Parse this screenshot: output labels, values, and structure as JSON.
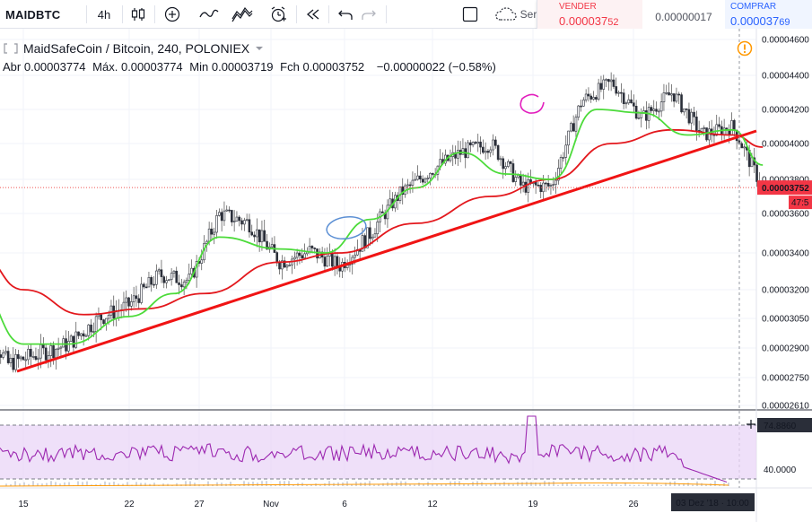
{
  "toolbar": {
    "symbol": "MAIDBTC",
    "interval": "4h",
    "server_label": "Ser",
    "icons": [
      "candles-icon",
      "add-indicator-icon",
      "line-style-icon",
      "indicators-icon",
      "alert-icon",
      "replay-icon",
      "undo-icon",
      "redo-icon",
      "checkbox-icon",
      "cloud-save-icon"
    ]
  },
  "trade": {
    "sell_label": "VENDER",
    "sell_price_main": "0.000037",
    "sell_price_accent": "52",
    "spread": "0.00000017",
    "buy_label": "COMPRAR",
    "buy_price_main": "0.000037",
    "buy_price_accent": "69",
    "sell_color": "#f23645",
    "buy_color": "#2962ff"
  },
  "legend": {
    "title": "MaidSafeCoin / Bitcoin, 240, POLONIEX",
    "open_label": "Abr",
    "open": "0.00003774",
    "high_label": "Máx.",
    "high": "0.00003774",
    "low_label": "Min",
    "low": "0.00003719",
    "close_label": "Fch",
    "close": "0.00003752",
    "change": "−0.00000022 (−0.58%)",
    "alert_icon": "warning-icon"
  },
  "price_axis": {
    "ticks": [
      "0.00004600",
      "0.00004400",
      "0.00004200",
      "0.00004000",
      "0.00003800",
      "0.00003600",
      "0.00003400",
      "0.00003200",
      "0.00003050",
      "0.00002900",
      "0.00002750",
      "0.00002610"
    ],
    "last_price": "0.00003752",
    "countdown": "47:5",
    "last_price_color": "#f23645"
  },
  "rsi_axis": {
    "upper_value": "74.8860",
    "lower_value": "40.0000"
  },
  "time_axis": {
    "ticks": [
      "15",
      "22",
      "27",
      "Nov",
      "6",
      "12",
      "19",
      "26"
    ],
    "crosshair_label": "03 Dez '18 · 10:00"
  },
  "chart_data": {
    "type": "line",
    "title": "MaidSafeCoin / Bitcoin, 240, POLONIEX",
    "xlabel": "",
    "ylabel": "",
    "ylim": [
      2.61e-05,
      4.6e-05
    ],
    "series": [
      {
        "name": "",
        "color": "#26a69a",
        "x": [
          "2018-10-12",
          "2018-10-14",
          "2018-10-16",
          "2018-10-18",
          "2018-10-20",
          "2018-10-22",
          "2018-10-24",
          "2018-10-26",
          "2018-10-28",
          "2018-10-30",
          "2018-11-01",
          "2018-11-03",
          "2018-11-05",
          "2018-11-07",
          "2018-11-09",
          "2018-11-11",
          "2018-11-13",
          "2018-11-15",
          "2018-11-17",
          "2018-11-19",
          "2018-11-21",
          "2018-11-23",
          "2018-11-25",
          "2018-11-27",
          "2018-11-29",
          "2018-12-01",
          "2018-12-03"
        ],
        "values": [
          3.06e-05,
          2.82e-05,
          2.87e-05,
          2.92e-05,
          3.05e-05,
          3.12e-05,
          3.28e-05,
          3.25e-05,
          3.6e-05,
          3.55e-05,
          3.35e-05,
          3.41e-05,
          3.33e-05,
          3.5e-05,
          3.72e-05,
          3.85e-05,
          3.95e-05,
          4e-05,
          3.76e-05,
          3.76e-05,
          4.25e-05,
          4.36e-05,
          4.15e-05,
          4.3e-05,
          4.05e-05,
          4.1e-05,
          3.75e-05
        ]
      },
      {
        "name": "",
        "color": "#4cdb3a",
        "x": [
          "2018-10-12",
          "2018-10-15",
          "2018-10-18",
          "2018-10-22",
          "2018-10-25",
          "2018-10-28",
          "2018-11-01",
          "2018-11-04",
          "2018-11-07",
          "2018-11-10",
          "2018-11-13",
          "2018-11-16",
          "2018-11-19",
          "2018-11-22",
          "2018-11-25",
          "2018-11-28",
          "2018-12-01",
          "2018-12-03"
        ],
        "values": [
          3.2e-05,
          2.92e-05,
          2.92e-05,
          3.06e-05,
          3.18e-05,
          3.48e-05,
          3.42e-05,
          3.4e-05,
          3.57e-05,
          3.75e-05,
          3.95e-05,
          3.83e-05,
          3.8e-05,
          4.2e-05,
          4.18e-05,
          4.05e-05,
          4.08e-05,
          3.88e-05
        ]
      },
      {
        "name": "",
        "color": "#e3181d",
        "x": [
          "2018-10-12",
          "2018-10-15",
          "2018-10-19",
          "2018-10-23",
          "2018-10-27",
          "2018-11-01",
          "2018-11-05",
          "2018-11-10",
          "2018-11-15",
          "2018-11-19",
          "2018-11-23",
          "2018-11-27",
          "2018-12-01",
          "2018-12-03"
        ],
        "values": [
          3.4e-05,
          3.2e-05,
          3.07e-05,
          3.1e-05,
          3.18e-05,
          3.35e-05,
          3.4e-05,
          3.55e-05,
          3.7e-05,
          3.8e-05,
          4e-05,
          4.08e-05,
          4.05e-05,
          3.98e-05
        ]
      }
    ]
  }
}
